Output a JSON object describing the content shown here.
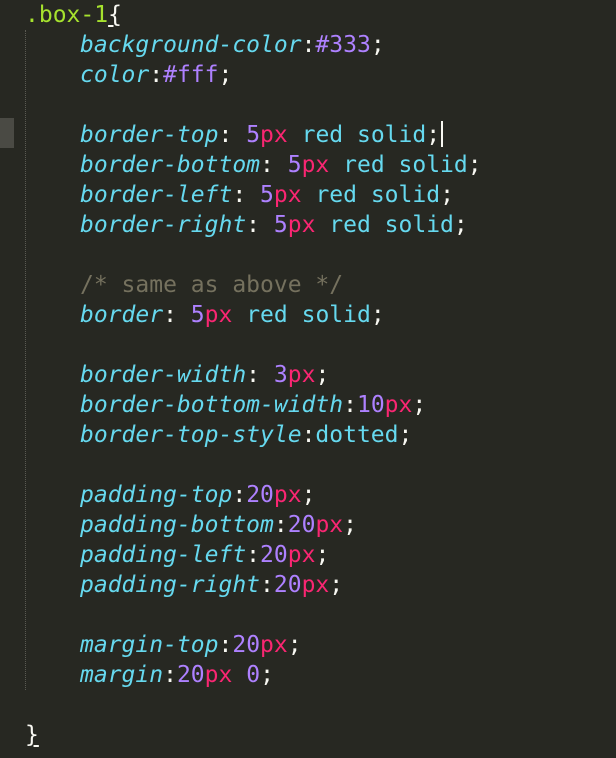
{
  "selector": ".box-1",
  "open_brace": "{",
  "close_brace": "}",
  "comment": "/* same as above */",
  "lines": {
    "bg": {
      "prop": "background-color",
      "sep": ":",
      "value": "#333",
      "end": ";"
    },
    "color": {
      "prop": "color",
      "sep": ":",
      "value": "#fff",
      "end": ";"
    },
    "bt": {
      "prop": "border-top",
      "sep": ": ",
      "num": "5",
      "unit": "px",
      "rest": " red solid",
      "end": ";"
    },
    "bb": {
      "prop": "border-bottom",
      "sep": ": ",
      "num": "5",
      "unit": "px",
      "rest": " red solid",
      "end": ";"
    },
    "bl": {
      "prop": "border-left",
      "sep": ": ",
      "num": "5",
      "unit": "px",
      "rest": " red solid",
      "end": ";"
    },
    "br": {
      "prop": "border-right",
      "sep": ": ",
      "num": "5",
      "unit": "px",
      "rest": " red solid",
      "end": ";"
    },
    "border": {
      "prop": "border",
      "sep": ": ",
      "num": "5",
      "unit": "px",
      "rest": " red solid",
      "end": ";"
    },
    "bw": {
      "prop": "border-width",
      "sep": ": ",
      "num": "3",
      "unit": "px",
      "end": ";"
    },
    "bbw": {
      "prop": "border-bottom-width",
      "sep": ":",
      "num": "10",
      "unit": "px",
      "end": ";"
    },
    "bts": {
      "prop": "border-top-style",
      "sep": ":",
      "rest": "dotted",
      "end": ";"
    },
    "pt": {
      "prop": "padding-top",
      "sep": ":",
      "num": "20",
      "unit": "px",
      "end": ";"
    },
    "pb": {
      "prop": "padding-bottom",
      "sep": ":",
      "num": "20",
      "unit": "px",
      "end": ";"
    },
    "pl": {
      "prop": "padding-left",
      "sep": ":",
      "num": "20",
      "unit": "px",
      "end": ";"
    },
    "pr": {
      "prop": "padding-right",
      "sep": ":",
      "num": "20",
      "unit": "px",
      "end": ";"
    },
    "mt": {
      "prop": "margin-top",
      "sep": ":",
      "num": "20",
      "unit": "px",
      "end": ";"
    },
    "m": {
      "prop": "margin",
      "sep": ":",
      "num": "20",
      "unit": "px",
      "num2": "0",
      "end": ";"
    }
  },
  "colors": {
    "background": "#272822",
    "property": "#66d9ef",
    "number": "#ae81ff",
    "unit": "#f92672",
    "selector": "#a6e22e",
    "comment": "#75715e",
    "text": "#f8f8f2"
  }
}
